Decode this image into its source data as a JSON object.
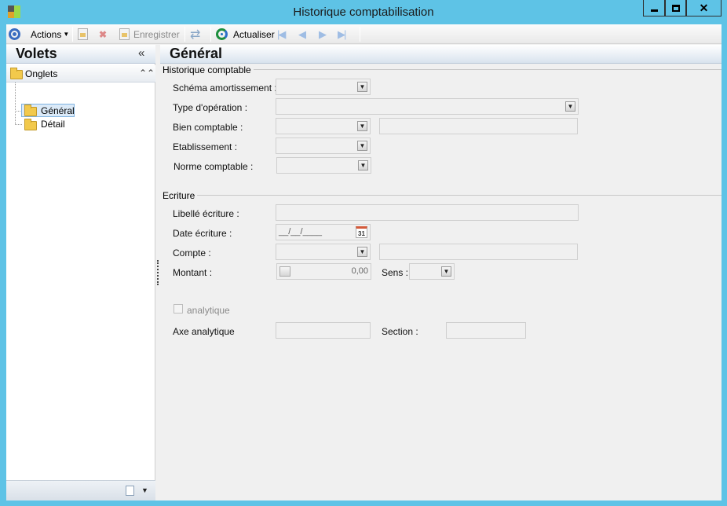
{
  "window": {
    "title": "Historique comptabilisation",
    "close_glyph": "✕"
  },
  "toolbar": {
    "actions_label": "Actions",
    "save_label": "Enregistrer",
    "refresh_label": "Actualiser"
  },
  "left_pane": {
    "title": "Volets",
    "collapse_glyph": "«",
    "group_label": "Onglets",
    "group_toggle_glyph": "⌃",
    "items": [
      {
        "label": "Général",
        "selected": true
      },
      {
        "label": "Détail",
        "selected": false
      }
    ]
  },
  "main": {
    "title": "Général",
    "groups": {
      "historique": {
        "label": "Historique comptable",
        "schema_label": "Schéma amortissement :",
        "type_label": "Type d'opération :",
        "bien_label": "Bien comptable :",
        "etab_label": "Etablissement :",
        "norme_label": "Norme comptable :"
      },
      "ecriture": {
        "label": "Ecriture",
        "libelle_label": "Libellé écriture :",
        "date_label": "Date écriture :",
        "date_mask": "__/__/____",
        "calendar_day": "31",
        "compte_label": "Compte :",
        "montant_label": "Montant :",
        "montant_value": "0,00",
        "sens_label": "Sens :",
        "analytique_label": "analytique",
        "axe_label": "Axe analytique",
        "section_label": "Section :"
      }
    }
  },
  "icons": {
    "combo": "chevron-double-down-icon",
    "dropdown": "chevron-down-icon"
  }
}
